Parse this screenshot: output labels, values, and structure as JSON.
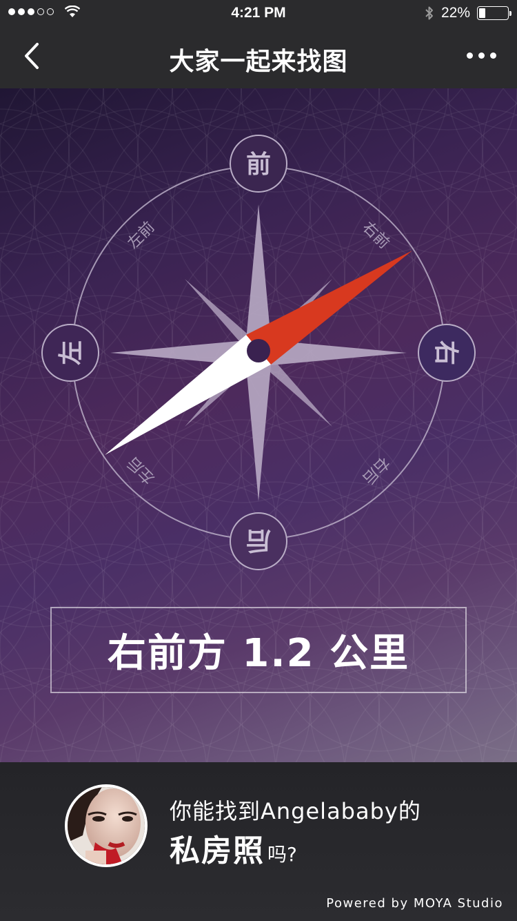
{
  "status_bar": {
    "time": "4:21 PM",
    "battery_percent": "22%",
    "battery_level": 0.22,
    "signal_bars_filled": 3,
    "signal_bars_total": 5,
    "icons": [
      "signal-dots-icon",
      "wifi-icon",
      "bluetooth-icon",
      "battery-icon"
    ]
  },
  "nav": {
    "title": "大家一起来找图",
    "back_icon": "chevron-left-icon",
    "more_icon": "more-dots-icon"
  },
  "compass": {
    "labels": {
      "front": "前",
      "back": "后",
      "left": "左",
      "right": "右",
      "front_left": "左前",
      "front_right": "右前",
      "back_left": "左后",
      "back_right": "右后"
    },
    "needle_heading_deg": 55,
    "colors": {
      "needle_primary": "#d8391f",
      "needle_secondary": "#ffffff",
      "star": "#b8aac4",
      "ring": "#b9adc6"
    }
  },
  "distance": {
    "text": "右前方 1.2 公里"
  },
  "promo": {
    "line1": "你能找到Angelababy的",
    "line2_strong": "私房照",
    "line2_tail": "吗?",
    "avatar_icon": "avatar-portrait"
  },
  "footer": {
    "powered_by": "Powered by MOYA Studio"
  }
}
